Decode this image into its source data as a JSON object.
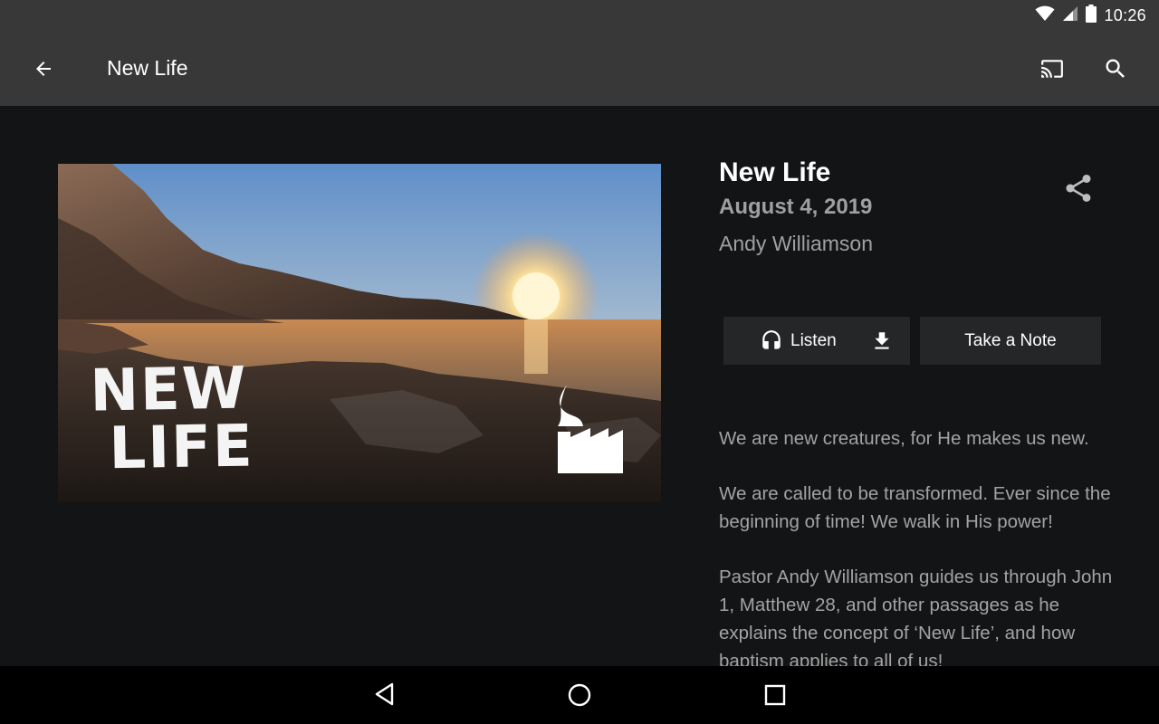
{
  "status_bar": {
    "time": "10:26",
    "icons": [
      "wifi-icon",
      "signal-icon",
      "battery-icon"
    ]
  },
  "app_bar": {
    "title": "New Life",
    "icons": [
      "back-arrow-icon",
      "cast-icon",
      "search-icon"
    ]
  },
  "artwork": {
    "title_line1": "NEW",
    "title_line2": "LIFE"
  },
  "sermon": {
    "title": "New Life",
    "date": "August 4, 2019",
    "speaker": "Andy Williamson"
  },
  "actions": {
    "listen_label": "Listen",
    "take_note_label": "Take a Note"
  },
  "description": {
    "paragraphs": [
      "We are new creatures, for He makes us new.",
      "We are called to be transformed. Ever since the beginning of time! We walk in His power!",
      "Pastor Andy Williamson guides us through John 1, Matthew 28, and other passages as he explains the concept of ‘New Life’, and how baptism applies to all of us!"
    ]
  },
  "colors": {
    "app_bar_bg": "#383838",
    "content_bg": "#131416",
    "button_bg": "#252628",
    "secondary_text": "#a0a0a0"
  }
}
